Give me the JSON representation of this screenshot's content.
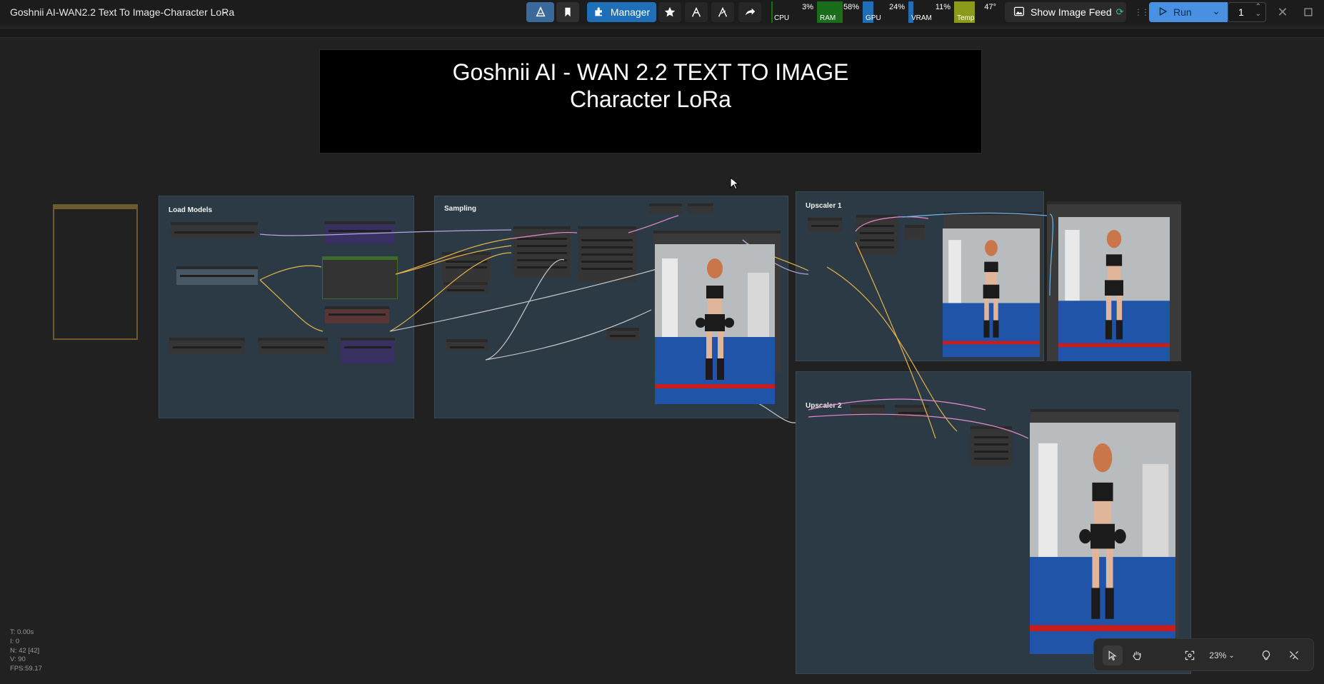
{
  "app": {
    "workflow_title": "Goshnii AI-WAN2.2 Text To Image-Character LoRa"
  },
  "toolbar": {
    "manager_label": "Manager",
    "show_image_feed_label": "Show Image Feed",
    "run_label": "Run",
    "batch_count": "1",
    "accent_color": "#1e6fb8"
  },
  "metrics": [
    {
      "label": "CPU",
      "value": "3%",
      "percent": 3,
      "color": "#1a6d1a"
    },
    {
      "label": "RAM",
      "value": "58%",
      "percent": 58,
      "color": "#1a6d1a"
    },
    {
      "label": "GPU",
      "value": "24%",
      "percent": 24,
      "color": "#1f6fb8"
    },
    {
      "label": "VRAM",
      "value": "11%",
      "percent": 11,
      "color": "#1f6fb8"
    },
    {
      "label": "Temp",
      "value": "47°",
      "percent": 47,
      "color": "#8c9a1a"
    }
  ],
  "canvas": {
    "note_line1": "Goshnii AI - WAN 2.2 TEXT TO IMAGE",
    "note_line2": "Character LoRa",
    "groups": {
      "load_models": "Load Models",
      "sampling": "Sampling",
      "upscaler_1": "Upscaler 1",
      "upscaler_2": "Upscaler 2"
    }
  },
  "status": {
    "time": "T: 0.00s",
    "iterations": "I: 0",
    "nodes": "N: 42 [42]",
    "vertices": "V: 90",
    "fps": "FPS:59.17"
  },
  "zoom": {
    "level": "23%"
  },
  "icons": [
    "comfy-logo-icon",
    "bookmark-icon",
    "puzzle-icon",
    "star-icon",
    "branch-icon",
    "branch-alt-icon",
    "share-icon",
    "image-icon",
    "refresh-icon",
    "drag-handle-icon",
    "play-icon",
    "chevron-down-icon",
    "chevron-up-icon",
    "close-icon",
    "window-icon",
    "pointer-icon",
    "hand-icon",
    "fit-view-icon",
    "lightbulb-icon",
    "link-off-icon"
  ]
}
